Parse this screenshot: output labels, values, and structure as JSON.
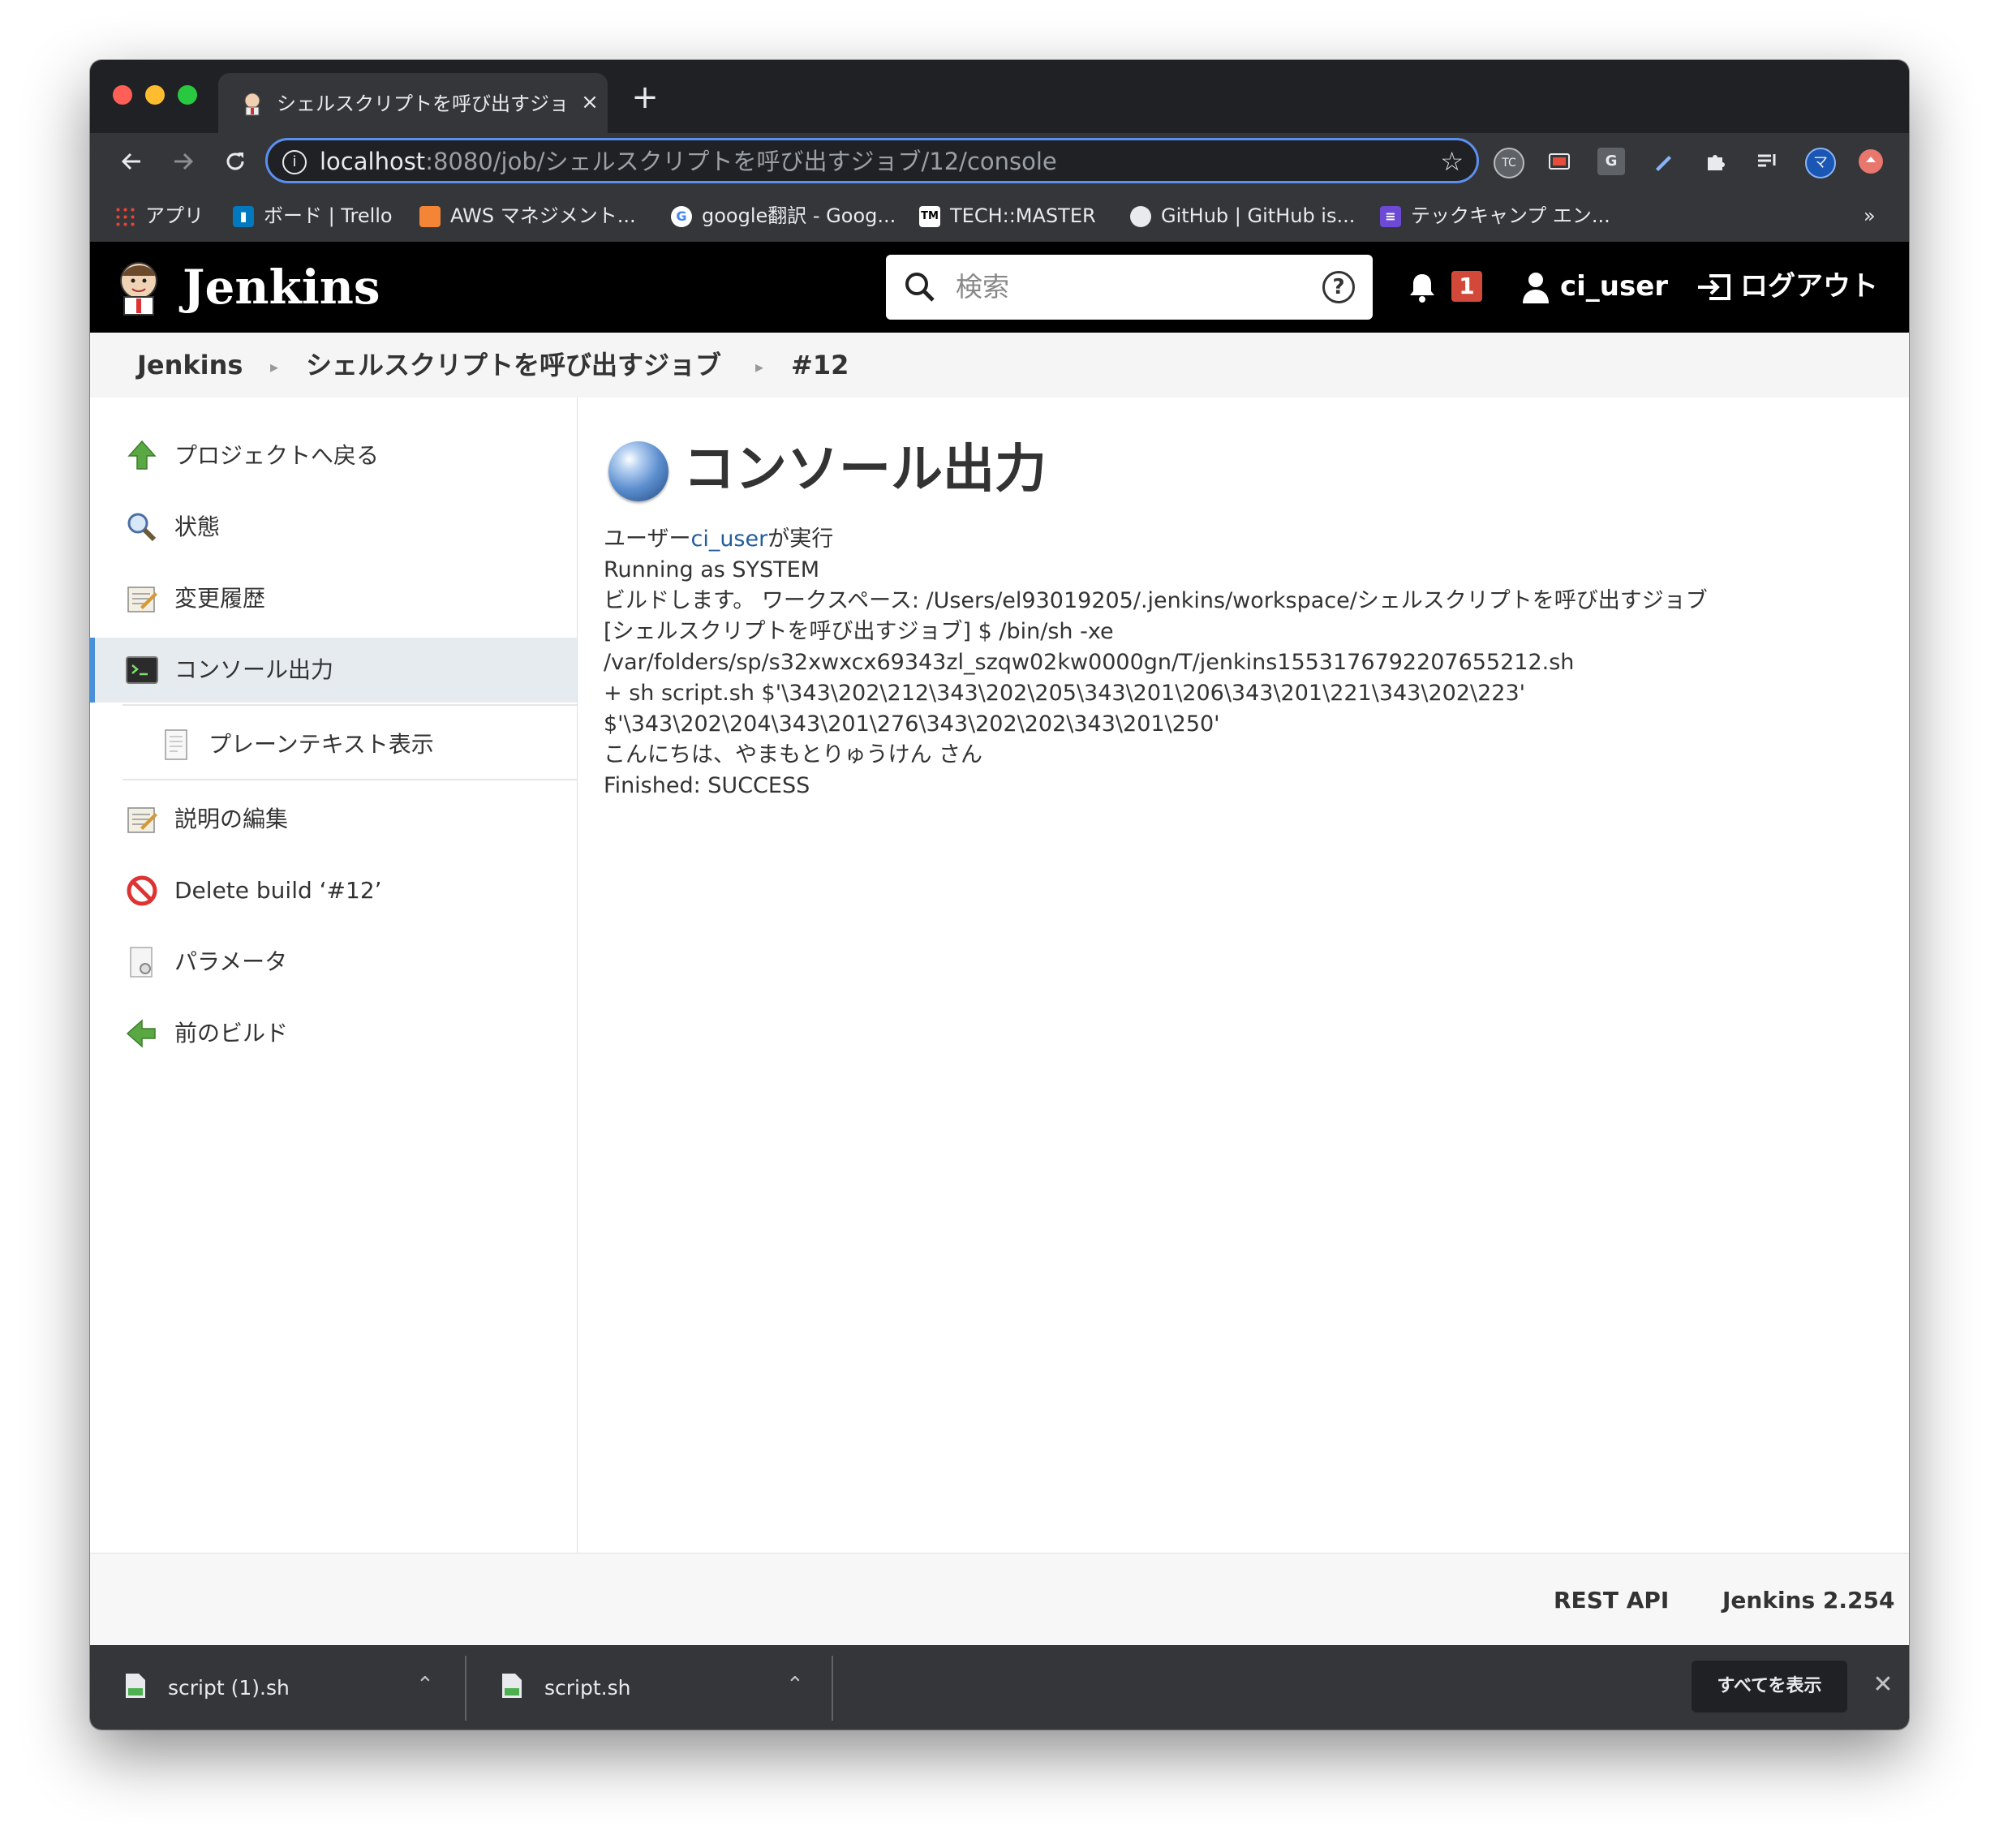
{
  "browser": {
    "tab_title": "シェルスクリプトを呼び出すジョブ",
    "tab_close": "×",
    "new_tab": "+",
    "url_host": "localhost",
    "url_path": ":8080/job/シェルスクリプトを呼び出すジョブ/12/console",
    "extensions": [
      "TC",
      "G"
    ],
    "profile_initial": "マ",
    "bookmarks": [
      {
        "label": "アプリ",
        "icon": "apps-grid-icon"
      },
      {
        "label": "ボード | Trello",
        "icon": "trello-icon"
      },
      {
        "label": "AWS マネジメント...",
        "icon": "aws-icon"
      },
      {
        "label": "google翻訳 - Goog...",
        "icon": "google-icon"
      },
      {
        "label": "TECH::MASTER",
        "icon": "techmaster-icon"
      },
      {
        "label": "GitHub | GitHub is...",
        "icon": "github-icon"
      },
      {
        "label": "テックキャンプ エン...",
        "icon": "techcamp-icon"
      }
    ],
    "bookmarks_overflow": "»"
  },
  "header": {
    "title": "Jenkins",
    "search_placeholder": "検索",
    "help": "?",
    "notification_count": "1",
    "user": "ci_user",
    "logout": "ログアウト"
  },
  "breadcrumb": [
    "Jenkins",
    "シェルスクリプトを呼び出すジョブ",
    "#12"
  ],
  "tasks": [
    {
      "label": "プロジェクトへ戻る",
      "icon": "up-arrow-icon"
    },
    {
      "label": "状態",
      "icon": "search-magnifier-icon"
    },
    {
      "label": "変更履歴",
      "icon": "notepad-icon"
    },
    {
      "label": "コンソール出力",
      "icon": "terminal-icon",
      "active": true
    },
    {
      "label": "プレーンテキスト表示",
      "icon": "document-icon",
      "sub": true
    },
    {
      "label": "説明の編集",
      "icon": "notepad-icon"
    },
    {
      "label": "Delete build ‘#12’",
      "icon": "no-entry-icon"
    },
    {
      "label": "パラメータ",
      "icon": "parameters-icon"
    },
    {
      "label": "前のビルド",
      "icon": "left-arrow-icon"
    }
  ],
  "main": {
    "title": "コンソール出力",
    "console": {
      "started_prefix": "ユーザー",
      "started_user": "ci_user",
      "started_suffix": "が実行",
      "lines": [
        "Running as SYSTEM",
        "ビルドします。 ワークスペース: /Users/el93019205/.jenkins/workspace/シェルスクリプトを呼び出すジョブ",
        "[シェルスクリプトを呼び出すジョブ] $ /bin/sh -xe",
        "/var/folders/sp/s32xwxcx69343zl_szqw02kw0000gn/T/jenkins1553176792207655212.sh",
        "+ sh script.sh $'\\343\\202\\212\\343\\202\\205\\343\\201\\206\\343\\201\\221\\343\\202\\223'",
        "$'\\343\\202\\204\\343\\201\\276\\343\\202\\202\\343\\201\\250'",
        "こんにちは、やまもとりゅうけん さん",
        "Finished: SUCCESS"
      ]
    }
  },
  "footer": {
    "rest_api": "REST API",
    "version": "Jenkins 2.254"
  },
  "downloads": {
    "items": [
      "script (1).sh",
      "script.sh"
    ],
    "show_all": "すべてを表示",
    "close": "✕"
  },
  "colors": {
    "accent_blue": "#4a90d9",
    "notification_red": "#d24939",
    "link_blue": "#235d9b"
  }
}
